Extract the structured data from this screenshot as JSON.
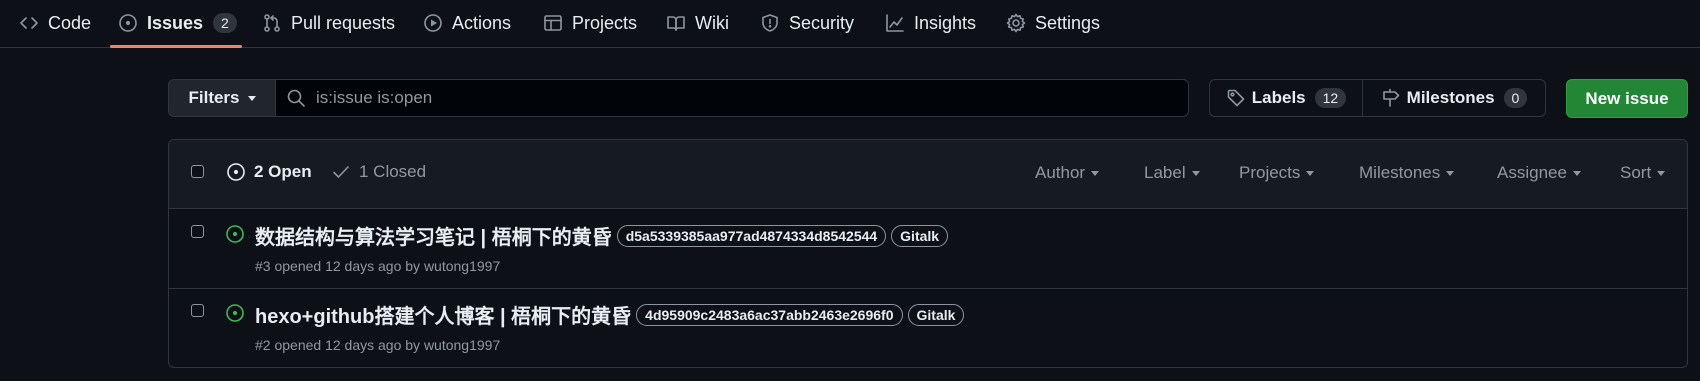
{
  "nav": {
    "tabs": [
      {
        "label": "Code",
        "icon": "code-icon"
      },
      {
        "label": "Issues",
        "icon": "issue-opened-icon",
        "count": "2",
        "active": true
      },
      {
        "label": "Pull requests",
        "icon": "git-pull-request-icon"
      },
      {
        "label": "Actions",
        "icon": "play-icon"
      },
      {
        "label": "Projects",
        "icon": "table-icon"
      },
      {
        "label": "Wiki",
        "icon": "book-icon"
      },
      {
        "label": "Security",
        "icon": "shield-icon"
      },
      {
        "label": "Insights",
        "icon": "graph-icon"
      },
      {
        "label": "Settings",
        "icon": "gear-icon"
      }
    ]
  },
  "toolbar": {
    "filters_label": "Filters",
    "search_value": "is:issue is:open",
    "labels_label": "Labels",
    "labels_count": "12",
    "milestones_label": "Milestones",
    "milestones_count": "0",
    "new_issue_label": "New issue"
  },
  "list_header": {
    "open_label": "2 Open",
    "closed_label": "1 Closed",
    "filters": [
      "Author",
      "Label",
      "Projects",
      "Milestones",
      "Assignee",
      "Sort"
    ]
  },
  "issues": [
    {
      "title": "数据结构与算法学习笔记 | 梧桐下的黄昏",
      "labels": [
        "d5a5339385aa977ad4874334d8542544",
        "Gitalk"
      ],
      "number": "#3",
      "opened": "opened 12 days ago by",
      "author": "wutong1997"
    },
    {
      "title": "hexo+github搭建个人博客 | 梧桐下的黄昏",
      "labels": [
        "4d95909c2483a6ac37abb2463e2696f0",
        "Gitalk"
      ],
      "number": "#2",
      "opened": "opened 12 days ago by",
      "author": "wutong1997"
    }
  ],
  "colors": {
    "background": "#0d1117",
    "border": "#30363d",
    "accent_underline": "#f78166",
    "open_green": "#3fb950",
    "new_issue_button": "#238636"
  }
}
